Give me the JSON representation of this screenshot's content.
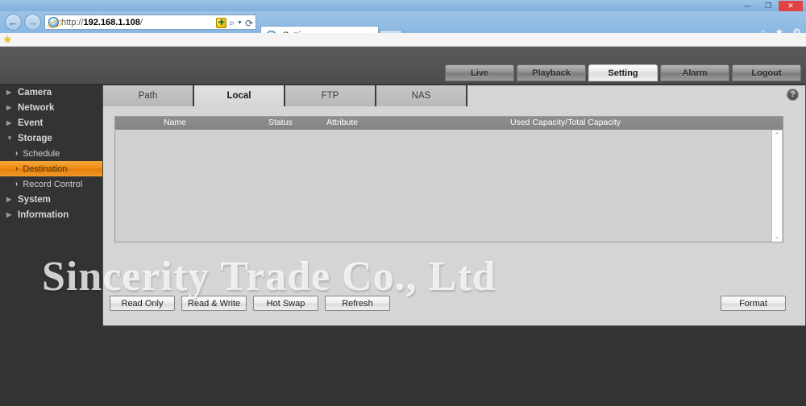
{
  "browser": {
    "window_controls": {
      "minimize": "—",
      "maximize": "❐",
      "close": "✕"
    },
    "back_arrow": "←",
    "forward_arrow": "→",
    "address": {
      "scheme": "http://",
      "host": "192.168.1.108",
      "path": "/",
      "full": "http://192.168.1.108/"
    },
    "address_icons": {
      "compatibility": "↻",
      "search": "⌕",
      "caret": "▼",
      "refresh": "⟳"
    },
    "tab": {
      "label": "Setting",
      "close": "✕"
    },
    "chrome_icons": {
      "home": "⌂",
      "favorites": "★",
      "tools": "⚙"
    },
    "favorites_bar": {
      "star": "★"
    }
  },
  "app": {
    "topnav": [
      {
        "label": "Live",
        "active": false
      },
      {
        "label": "Playback",
        "active": false
      },
      {
        "label": "Setting",
        "active": true
      },
      {
        "label": "Alarm",
        "active": false
      },
      {
        "label": "Logout",
        "active": false
      }
    ],
    "sidebar": [
      {
        "label": "Camera",
        "type": "group",
        "marker": "▶"
      },
      {
        "label": "Network",
        "type": "group",
        "marker": "▶"
      },
      {
        "label": "Event",
        "type": "group",
        "marker": "▶"
      },
      {
        "label": "Storage",
        "type": "group",
        "marker": "▼",
        "expanded": true
      },
      {
        "label": "Schedule",
        "type": "sub",
        "marker": "›",
        "active": false
      },
      {
        "label": "Destination",
        "type": "sub",
        "marker": "›",
        "active": true
      },
      {
        "label": "Record Control",
        "type": "sub",
        "marker": "›",
        "active": false
      },
      {
        "label": "System",
        "type": "group",
        "marker": "▶"
      },
      {
        "label": "Information",
        "type": "group",
        "marker": "▶"
      }
    ],
    "subtabs": [
      {
        "label": "Path",
        "active": false
      },
      {
        "label": "Local",
        "active": true
      },
      {
        "label": "FTP",
        "active": false
      },
      {
        "label": "NAS",
        "active": false
      }
    ],
    "help_icon": "?",
    "table": {
      "columns": [
        "Name",
        "Status",
        "Attribute",
        "Used Capacity/Total Capacity"
      ],
      "rows": []
    },
    "scrollbar": {
      "up": "⌃",
      "down": "⌄"
    },
    "buttons": [
      {
        "label": "Read Only"
      },
      {
        "label": "Read & Write"
      },
      {
        "label": "Hot Swap"
      },
      {
        "label": "Refresh"
      }
    ],
    "format_button": {
      "label": "Format"
    },
    "watermark": "Sincerity Trade Co., Ltd"
  },
  "colors": {
    "accent_orange": "#ef8b12",
    "app_dark": "#333333",
    "panel_gray": "#d5d5d5",
    "header_gray": "#535353",
    "browser_blue": "#8ab8e3"
  }
}
